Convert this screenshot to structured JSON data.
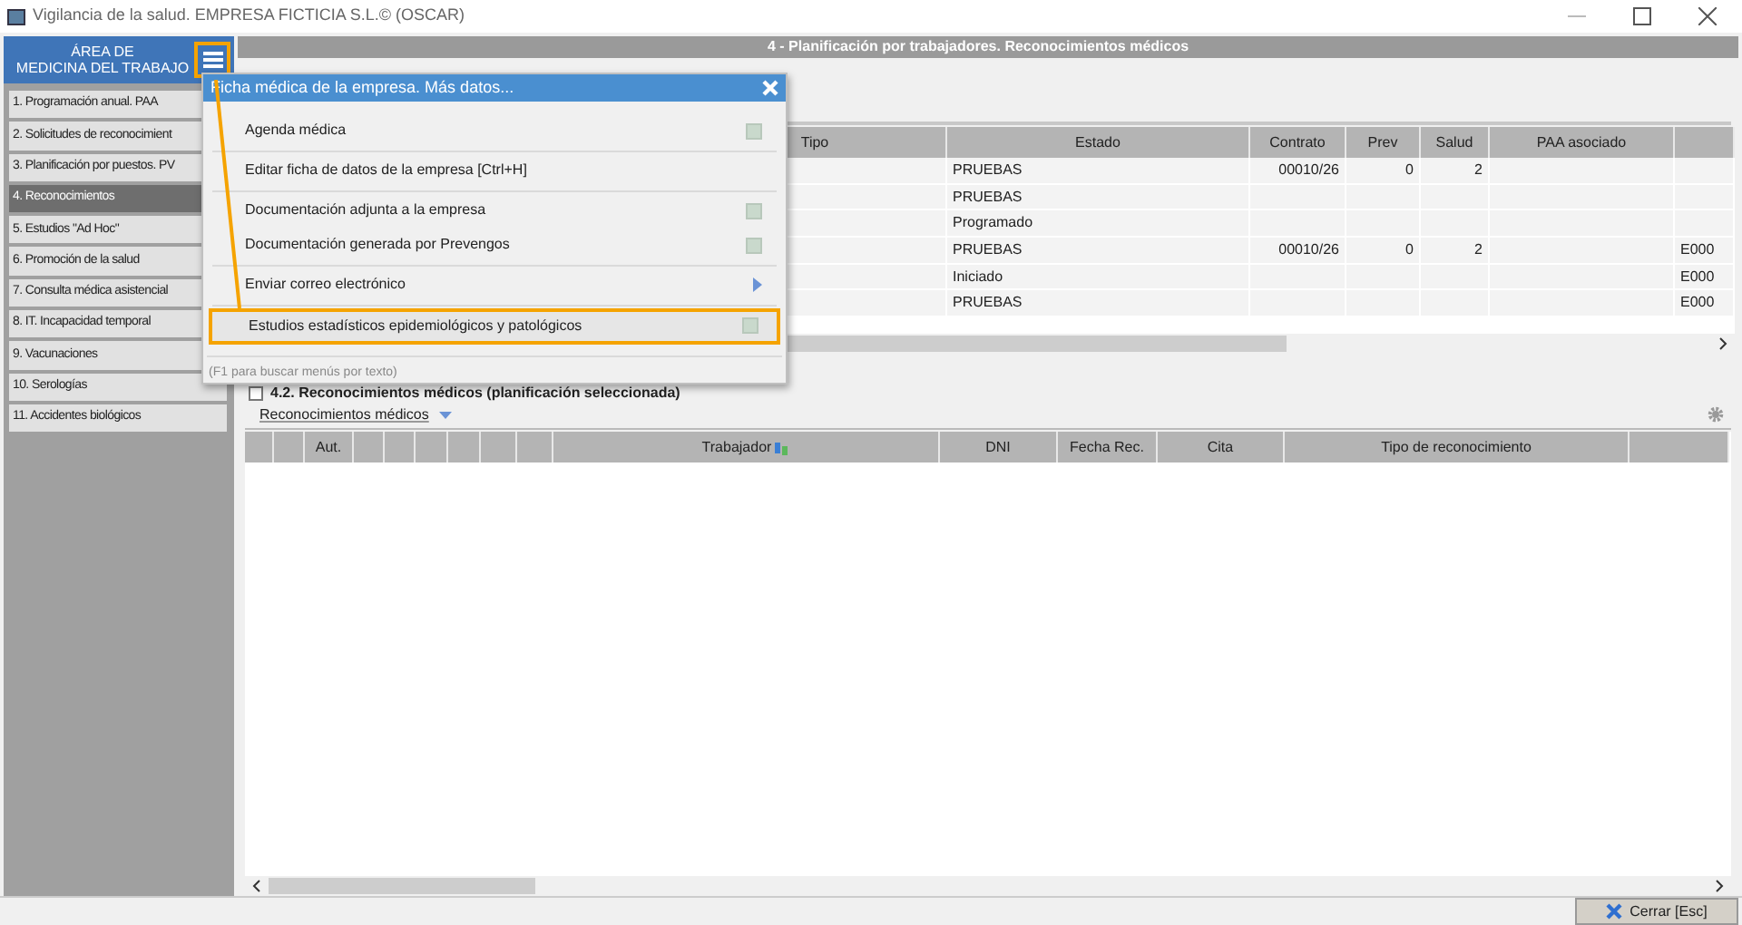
{
  "window": {
    "title": "Vigilancia de la salud.  EMPRESA FICTICIA S.L.© (OSCAR)"
  },
  "sidebar": {
    "title": "ÁREA DE\nMEDICINA DEL TRABAJO",
    "items": [
      {
        "label": "1. Programación anual. PAA",
        "selected": false
      },
      {
        "label": "2. Solicitudes de reconocimient",
        "selected": false
      },
      {
        "label": "3. Planificación por puestos. PV",
        "selected": false
      },
      {
        "label": "4. Reconocimientos",
        "selected": true
      },
      {
        "label": "5. Estudios \"Ad Hoc\"",
        "selected": false
      },
      {
        "label": "6. Promoción de la salud",
        "selected": false
      },
      {
        "label": "7. Consulta médica asistencial",
        "selected": false
      },
      {
        "label": "8. IT. Incapacidad temporal",
        "selected": false
      },
      {
        "label": "9. Vacunaciones",
        "selected": false
      },
      {
        "label": "10. Serologías",
        "selected": false
      },
      {
        "label": "11. Accidentes biológicos",
        "selected": false
      }
    ]
  },
  "panel_title": "4 - Planificación por trabajadores. Reconocimientos médicos",
  "plan_table": {
    "columns": [
      "Tipo",
      "Estado",
      "Contrato",
      "Prev",
      "Salud",
      "PAA asociado",
      ""
    ],
    "rows": [
      [
        "",
        "PRUEBAS",
        "00010/26",
        "0",
        "2",
        "",
        ""
      ],
      [
        "",
        "PRUEBAS",
        "",
        "",
        "",
        "",
        ""
      ],
      [
        "",
        "Programado",
        "",
        "",
        "",
        "",
        ""
      ],
      [
        "",
        "PRUEBAS",
        "00010/26",
        "0",
        "2",
        "",
        "E000"
      ],
      [
        "",
        "Iniciado",
        "",
        "",
        "",
        "",
        "E000"
      ],
      [
        "",
        "PRUEBAS",
        "",
        "",
        "",
        "",
        "E000"
      ]
    ]
  },
  "section_2": {
    "title": "4.2. Reconocimientos médicos (planificación seleccionada)",
    "checked": false,
    "dropdown": "Reconocimientos médicos",
    "columns": [
      "",
      "",
      "Aut.",
      "",
      "",
      "",
      "",
      "",
      "",
      "Trabajador",
      "DNI",
      "Fecha Rec.",
      "Cita",
      "Tipo de reconocimiento",
      ""
    ]
  },
  "menu": {
    "title": "Ficha médica de la empresa. Más datos...",
    "items": [
      {
        "label": "Agenda médica",
        "kind": "info",
        "selected": false,
        "divider": true
      },
      {
        "label": "Editar ficha de datos de la empresa  [Ctrl+H]",
        "kind": "plain",
        "selected": false,
        "divider": true
      },
      {
        "label": "Documentación adjunta a la empresa",
        "kind": "info",
        "selected": false,
        "divider": false
      },
      {
        "label": "Documentación generada por Prevengos",
        "kind": "info",
        "selected": false,
        "divider": true
      },
      {
        "label": "Enviar correo electrónico",
        "kind": "submenu",
        "selected": false,
        "divider": true
      },
      {
        "label": "Estudios estadísticos epidemiológicos y patológicos",
        "kind": "info",
        "selected": true,
        "divider": false
      }
    ],
    "hint": "(F1 para buscar menús por texto)"
  },
  "close_button": "Cerrar  [Esc]"
}
